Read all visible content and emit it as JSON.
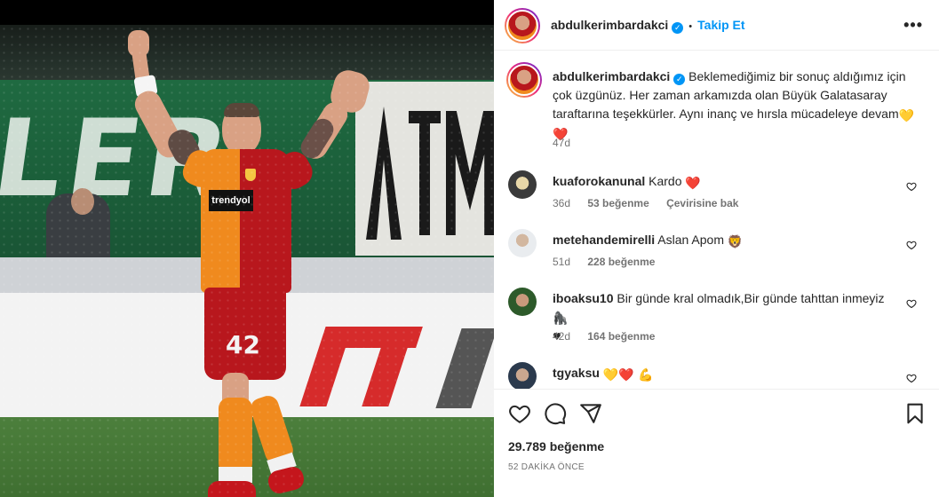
{
  "post": {
    "author": "abdulkerimbardakci",
    "follow_label": "Takip Et",
    "more_label": "•••",
    "separator": "•",
    "verified_mark": "✓",
    "caption": {
      "text": "Beklemediğimiz bir sonuç aldığımız için çok üzgünüz. Her zaman arkamızda olan Büyük Galatasaray taraftarına teşekkürler. Aynı inanç ve hırsla mücadeleye devam",
      "emojis": [
        "💛",
        "❤️"
      ],
      "time": "47d"
    },
    "likes": "29.789 beğenme",
    "time_ago": "52 DAKİKA ÖNCE"
  },
  "photo": {
    "sponsor": "trendyol",
    "jersey_number": "42",
    "banner_text": "LER",
    "banner_text_right": "ATM",
    "ad_text": "A"
  },
  "comments": [
    {
      "user": "kuaforokanunal",
      "text": "Kardo",
      "emoji": "❤️",
      "time": "36d",
      "likes": "53 beğenme",
      "translate": "Çevirisine bak"
    },
    {
      "user": "metehandemirelli",
      "text": "Aslan Apom",
      "emoji": "🦁",
      "time": "51d",
      "likes": "228 beğenme"
    },
    {
      "user": "iboaksu10",
      "text": "Bir günde kral olmadık,Bir günde tahttan inmeyiz",
      "emoji": "🦍",
      "emoji2": "♥",
      "time": "42d",
      "likes": "164 beğenme"
    },
    {
      "user": "tgyaksu",
      "text": "",
      "emoji": "💛❤️ 💪"
    }
  ],
  "icons": {
    "like": "heart-icon",
    "comment": "comment-icon",
    "share": "share-icon",
    "save": "bookmark-icon",
    "more": "more-icon"
  },
  "colors": {
    "accent": "#0095f6",
    "heart_red": "#ed4956",
    "galatasaray_red": "#b8171d",
    "galatasaray_orange": "#f08a1e"
  }
}
